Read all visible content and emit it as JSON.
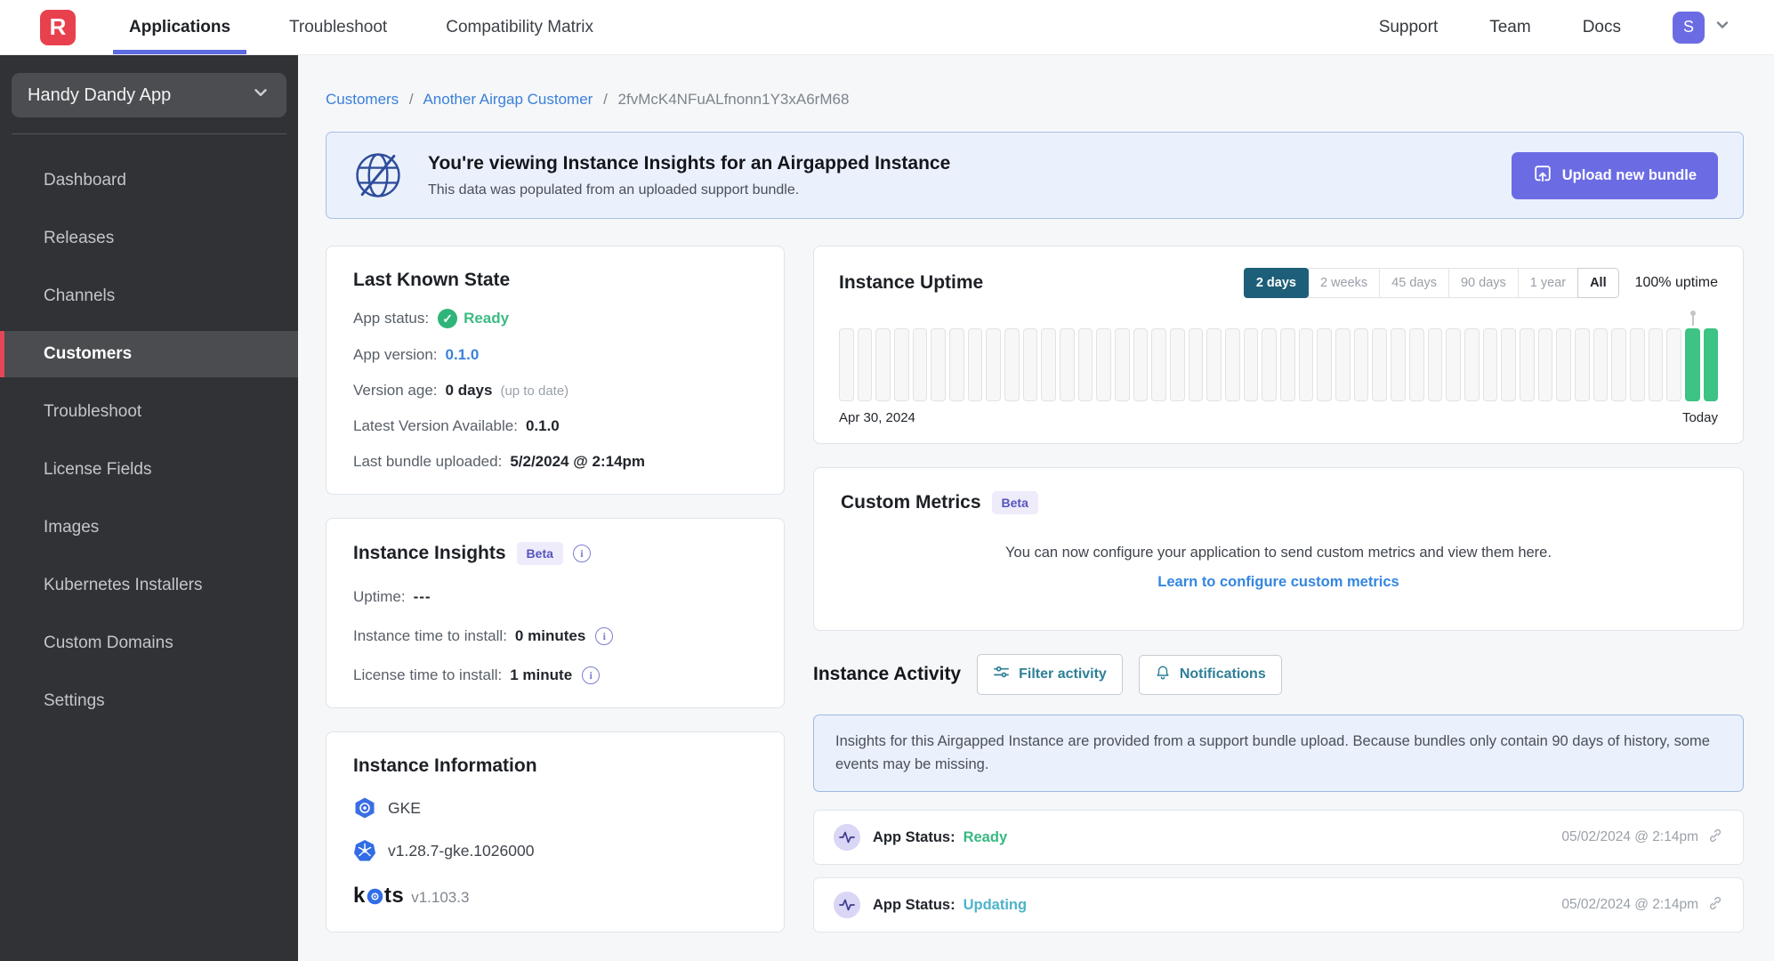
{
  "header": {
    "logo_letter": "R",
    "nav": [
      {
        "label": "Applications"
      },
      {
        "label": "Troubleshoot"
      },
      {
        "label": "Compatibility Matrix"
      }
    ],
    "right_links": [
      {
        "label": "Support"
      },
      {
        "label": "Team"
      },
      {
        "label": "Docs"
      }
    ],
    "avatar_initial": "S"
  },
  "sidebar": {
    "app_selector": "Handy Dandy App",
    "items": [
      {
        "label": "Dashboard"
      },
      {
        "label": "Releases"
      },
      {
        "label": "Channels"
      },
      {
        "label": "Customers"
      },
      {
        "label": "Troubleshoot"
      },
      {
        "label": "License Fields"
      },
      {
        "label": "Images"
      },
      {
        "label": "Kubernetes Installers"
      },
      {
        "label": "Custom Domains"
      },
      {
        "label": "Settings"
      }
    ]
  },
  "breadcrumb": {
    "parts": [
      {
        "label": "Customers"
      },
      {
        "label": "Another Airgap Customer"
      },
      {
        "label": "2fvMcK4NFuALfnonn1Y3xA6rM68"
      }
    ],
    "separator": "/"
  },
  "banner": {
    "title": "You're viewing Instance Insights for an Airgapped Instance",
    "subtitle": "This data was populated from an uploaded support bundle.",
    "upload_button": "Upload new bundle"
  },
  "last_known_state": {
    "title": "Last Known State",
    "app_status_label": "App status:",
    "app_status_value": "Ready",
    "app_version_label": "App version:",
    "app_version_value": "0.1.0",
    "version_age_label": "Version age:",
    "version_age_value": "0 days",
    "version_age_note": "(up to date)",
    "latest_version_label": "Latest Version Available:",
    "latest_version_value": "0.1.0",
    "last_bundle_label": "Last bundle uploaded:",
    "last_bundle_value": "5/2/2024 @ 2:14pm"
  },
  "instance_insights": {
    "title": "Instance Insights",
    "badge": "Beta",
    "uptime_label": "Uptime:",
    "uptime_value": "---",
    "instance_install_label": "Instance time to install:",
    "instance_install_value": "0 minutes",
    "license_install_label": "License time to install:",
    "license_install_value": "1 minute"
  },
  "instance_information": {
    "title": "Instance Information",
    "distribution": "GKE",
    "k8s_version": "v1.28.7-gke.1026000",
    "kots_name": "k",
    "kots_name_rest": "ts",
    "kots_version": "v1.103.3"
  },
  "uptime_card": {
    "title": "Instance Uptime",
    "ranges": [
      {
        "label": "2 days",
        "active": true
      },
      {
        "label": "2 weeks"
      },
      {
        "label": "45 days"
      },
      {
        "label": "90 days"
      },
      {
        "label": "1 year"
      },
      {
        "label": "All"
      }
    ],
    "uptime_text": "100% uptime",
    "start_label": "Apr 30, 2024",
    "end_label": "Today",
    "bars_total": 48,
    "bars_up_last": 2
  },
  "chart_data": {
    "type": "bar",
    "title": "Instance Uptime",
    "x_start": "Apr 30, 2024",
    "x_end": "Today",
    "bars_total": 48,
    "bars_no_data": 46,
    "bars_up": 2,
    "uptime_percent": "100% uptime",
    "note": "48 interval bars; first 46 empty (no data), last 2 green (up)"
  },
  "custom_metrics": {
    "title": "Custom Metrics",
    "badge": "Beta",
    "body": "You can now configure your application to send custom metrics and view them here.",
    "link": "Learn to configure custom metrics"
  },
  "activity": {
    "title": "Instance Activity",
    "filter_button": "Filter activity",
    "notifications_button": "Notifications",
    "notice": "Insights for this Airgapped Instance are provided from a support bundle upload. Because bundles only contain 90 days of history, some events may be missing.",
    "rows": [
      {
        "label": "App Status:",
        "value": "Ready",
        "timestamp": "05/02/2024 @ 2:14pm"
      },
      {
        "label": "App Status:",
        "value": "Updating",
        "timestamp": "05/02/2024 @ 2:14pm"
      }
    ]
  },
  "colors": {
    "accent_purple": "#6b6ce4",
    "accent_red": "#e8414d",
    "active_teal": "#1d5f78",
    "success_green": "#3dc383",
    "updating_teal": "#4eb4c9",
    "link_blue": "#3a7fd8",
    "banner_bg": "#ebf1fc"
  }
}
